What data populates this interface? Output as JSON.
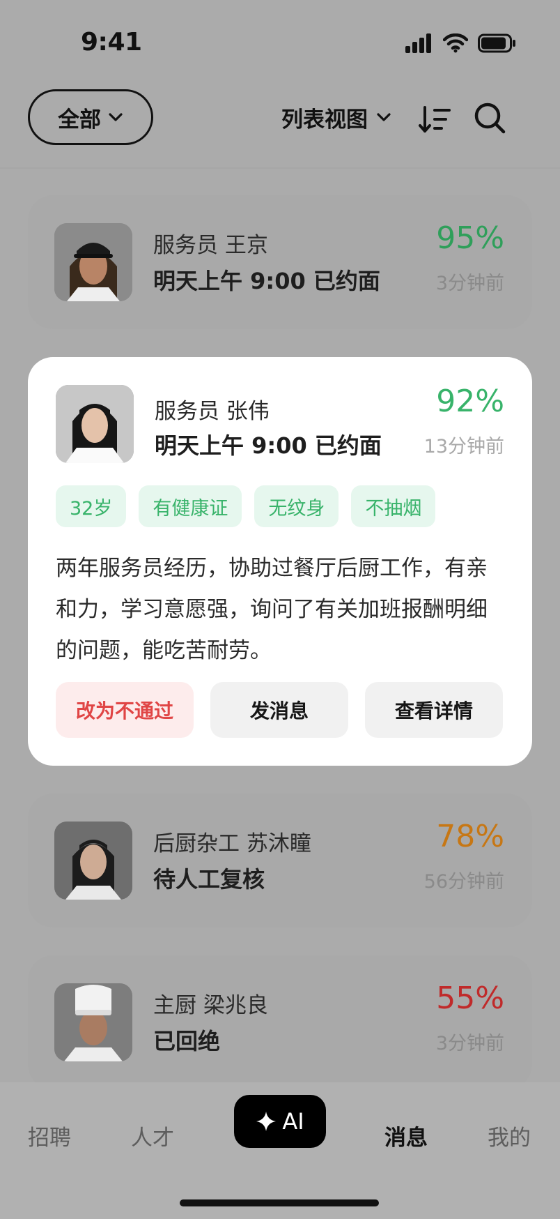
{
  "status_bar": {
    "time": "9:41"
  },
  "toolbar": {
    "filter_label": "全部",
    "view_label": "列表视图"
  },
  "candidates": [
    {
      "role": "服务员",
      "name": "王京",
      "status": "明天上午 9:00 已约面",
      "score": "95%",
      "score_color": "#2f9f5a",
      "time_ago": "3分钟前"
    },
    {
      "role": "服务员",
      "name": "张伟",
      "status": "明天上午 9:00 已约面",
      "score": "92%",
      "score_color": "#38b36a",
      "time_ago": "13分钟前",
      "tags": [
        "32岁",
        "有健康证",
        "无纹身",
        "不抽烟"
      ],
      "description": "两年服务员经历，协助过餐厅后厨工作，有亲和力，学习意愿强，询问了有关加班报酬明细的问题，能吃苦耐劳。",
      "actions": {
        "reject": "改为不通过",
        "message": "发消息",
        "details": "查看详情"
      }
    },
    {
      "role": "后厨杂工",
      "name": "苏沐瞳",
      "status": "待人工复核",
      "score": "78%",
      "score_color": "#c77714",
      "time_ago": "56分钟前"
    },
    {
      "role": "主厨",
      "name": "梁兆良",
      "status": "已回绝",
      "score": "55%",
      "score_color": "#c02a2a",
      "time_ago": "3分钟前"
    }
  ],
  "tabbar": {
    "tabs": [
      "招聘",
      "人才",
      "AI",
      "消息",
      "我的"
    ],
    "current": "消息"
  }
}
